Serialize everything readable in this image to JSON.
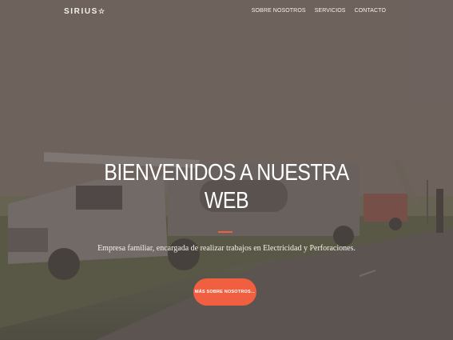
{
  "header": {
    "brand": "SIRIUS",
    "brand_star": "☆",
    "nav": [
      "SOBRE NOSOTROS",
      "SERVICIOS",
      "CONTACTO"
    ]
  },
  "hero": {
    "headline_line1": "BIENVENIDOS A NUESTRA",
    "headline_line2": "WEB",
    "tagline": "Empresa familiar, encargada de realizar trabajos en Electricidad y Perforaciones.",
    "cta_label": "MÁS SOBRE NOSOTROS..."
  },
  "colors": {
    "accent": "#f05f40",
    "text": "#ffffff"
  },
  "icons": {
    "brand_mark": "star-outline-icon"
  }
}
